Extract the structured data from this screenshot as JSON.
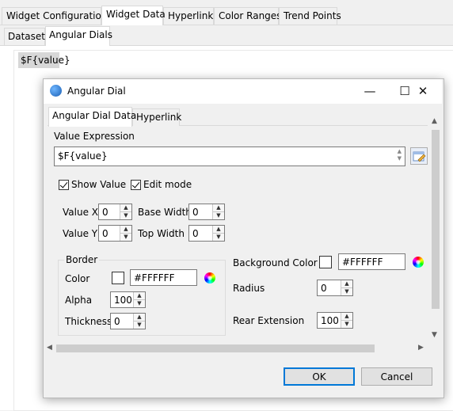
{
  "outer_tabs": [
    {
      "label": "Widget Configuration"
    },
    {
      "label": "Widget Data",
      "active": true
    },
    {
      "label": "Hyperlink"
    },
    {
      "label": "Color Ranges"
    },
    {
      "label": "Trend Points"
    }
  ],
  "sub_tabs": [
    {
      "label": "Dataset"
    },
    {
      "label": "Angular Dials",
      "active": true
    }
  ],
  "content": {
    "value_chip": "$F{value}"
  },
  "dialog": {
    "title": "Angular Dial",
    "window_buttons": {
      "minimize": "—",
      "maximize": "☐",
      "close": "✕"
    },
    "tabs": [
      {
        "label": "Angular Dial Data",
        "active": true
      },
      {
        "label": "Hyperlink"
      }
    ],
    "value_expression": {
      "label": "Value Expression",
      "value": "$F{value}"
    },
    "show_value": {
      "label": "Show Value",
      "checked": true
    },
    "edit_mode": {
      "label": "Edit mode",
      "checked": true
    },
    "value_x": {
      "label": "Value X",
      "value": "0"
    },
    "value_y": {
      "label": "Value Y",
      "value": "0"
    },
    "base_width": {
      "label": "Base Width",
      "value": "0"
    },
    "top_width": {
      "label": "Top Width",
      "value": "0"
    },
    "border": {
      "title": "Border",
      "color_label": "Color",
      "color_value": "#FFFFFF",
      "alpha_label": "Alpha",
      "alpha_value": "100",
      "thickness_label": "Thickness",
      "thickness_value": "0"
    },
    "background_color": {
      "label": "Background Color",
      "value": "#FFFFFF"
    },
    "radius": {
      "label": "Radius",
      "value": "0"
    },
    "rear_extension": {
      "label": "Rear Extension",
      "value": "100"
    },
    "buttons": {
      "ok": "OK",
      "cancel": "Cancel"
    }
  },
  "colors": {
    "accent": "#0078d7",
    "swatch": "#FFFFFF"
  }
}
